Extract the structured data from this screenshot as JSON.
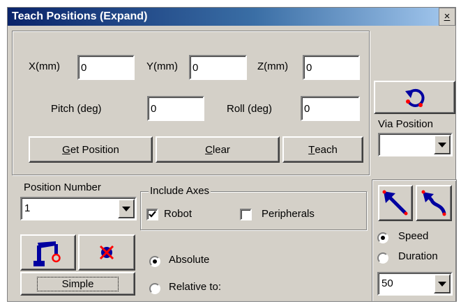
{
  "window": {
    "title": "Teach Positions (Expand)",
    "close_glyph": "×"
  },
  "coords": {
    "x": {
      "label": "X(mm)",
      "value": "0"
    },
    "y": {
      "label": "Y(mm)",
      "value": "0"
    },
    "z": {
      "label": "Z(mm)",
      "value": "0"
    },
    "pitch": {
      "label": "Pitch (deg)",
      "value": "0"
    },
    "roll": {
      "label": "Roll (deg)",
      "value": "0"
    }
  },
  "actions": {
    "get_position": {
      "underline": "G",
      "rest": "et Position"
    },
    "clear": {
      "underline": "C",
      "rest": "lear"
    },
    "teach": {
      "underline": "T",
      "rest": "each"
    }
  },
  "via": {
    "label": "Via Position",
    "value": ""
  },
  "position_number": {
    "label": "Position Number",
    "value": "1"
  },
  "include_axes": {
    "label": "Include Axes",
    "robot": {
      "label": "Robot",
      "checked": true
    },
    "peripherals": {
      "label": "Peripherals",
      "checked": false
    }
  },
  "mode": {
    "absolute": {
      "label": "Absolute",
      "selected": true
    },
    "relative": {
      "label": "Relative to:",
      "selected": false
    }
  },
  "simple_button": "Simple",
  "motion": {
    "speed": {
      "label": "Speed",
      "selected": true
    },
    "duration": {
      "label": "Duration",
      "selected": false
    },
    "value": "50"
  },
  "colors": {
    "title_start": "#0a246a",
    "title_end": "#a6caf0",
    "face": "#d4d0c8",
    "icon_blue": "#0000a0",
    "icon_red": "#ff0000"
  }
}
